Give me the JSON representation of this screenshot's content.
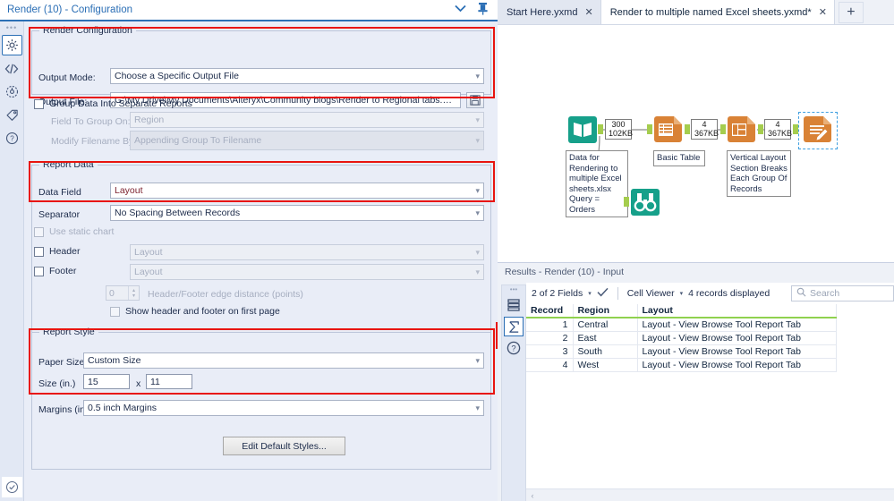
{
  "config": {
    "title": "Render (10) - Configuration",
    "collapse_icon": "chevron-down-icon",
    "pin_icon": "pin-icon",
    "rail": [
      {
        "name": "gear-icon",
        "label": "Configuration"
      },
      {
        "name": "code-icon",
        "label": "XML"
      },
      {
        "name": "annotation-icon",
        "label": "Annotation"
      },
      {
        "name": "tag-icon",
        "label": "Tag"
      },
      {
        "name": "help-icon",
        "label": "Help"
      }
    ],
    "status_icon": "check-circle-icon",
    "render_configuration": {
      "legend": "Render Configuration",
      "output_mode_label": "Output Mode:",
      "output_mode_value": "Choose a Specific Output File",
      "output_file_label": "Output File:",
      "output_file_value": "G:\\My Drive\\My Documents\\Alteryx\\Community blogs\\Render to Regional tabs.xlsx",
      "save_icon": "save-disk-icon"
    },
    "grouping": {
      "group_checkbox_label": "Group Data Into Separate Reports",
      "group_checked": false,
      "field_to_group_label": "Field To Group On:",
      "field_to_group_value": "Region",
      "modify_filename_label": "Modify Filename By:",
      "modify_filename_value": "Appending Group To Filename"
    },
    "report_data": {
      "legend": "Report Data",
      "data_field_label": "Data Field",
      "data_field_value": "Layout",
      "separator_label": "Separator",
      "separator_value": "No Spacing Between Records",
      "use_static_chart_label": "Use static chart",
      "use_static_chart_checked": false,
      "header_label": "Header",
      "header_value": "Layout",
      "header_checked": false,
      "footer_label": "Footer",
      "footer_value": "Layout",
      "footer_checked": false,
      "edge_distance_value": "0",
      "edge_distance_label": "Header/Footer edge distance (points)",
      "show_hf_first_page_label": "Show header and footer on first page",
      "show_hf_first_page_checked": false
    },
    "report_style": {
      "legend": "Report Style",
      "paper_size_label": "Paper Size",
      "paper_size_value": "Custom Size",
      "size_label": "Size (in.)",
      "size_width": "15",
      "size_x": "x",
      "size_height": "11",
      "margins_label": "Margins (in.)",
      "margins_value": "0.5 inch Margins",
      "edit_styles_button": "Edit Default Styles..."
    },
    "highlight_color": "#e8150f"
  },
  "tabs": {
    "items": [
      {
        "label": "Start Here.yxmd",
        "active": false,
        "close_icon": "close-icon"
      },
      {
        "label": "Render to multiple named Excel sheets.yxmd*",
        "active": true,
        "close_icon": "close-icon"
      }
    ],
    "add_label": "+",
    "add_icon": "plus-icon"
  },
  "canvas": {
    "tools": [
      {
        "name": "input-data-tool",
        "icon": "book-icon",
        "color": "#16a08a",
        "annotation": "Data for\nRendering to\nmultiple Excel\nsheets.xlsx\nQuery = Orders"
      },
      {
        "name": "basic-table-tool",
        "icon": "table-icon",
        "color": "#d98236",
        "annotation": "Basic Table"
      },
      {
        "name": "layout-tool",
        "icon": "layout-icon",
        "color": "#d98236",
        "annotation": "Vertical Layout\nSection Breaks\nEach Group Of\nRecords"
      },
      {
        "name": "render-tool",
        "icon": "render-icon",
        "color": "#d98236",
        "annotation": "",
        "selected": true
      },
      {
        "name": "browse-tool",
        "icon": "binoculars-icon",
        "color": "#16a08a",
        "annotation": ""
      }
    ],
    "connections": [
      {
        "records": "300",
        "size": "102KB"
      },
      {
        "records": "4",
        "size": "367KB"
      },
      {
        "records": "4",
        "size": "367KB"
      }
    ]
  },
  "results": {
    "title": "Results - Render (10) - Input",
    "rail": [
      {
        "name": "records-icon"
      },
      {
        "name": "sigma-icon",
        "active": true
      },
      {
        "name": "help-icon"
      }
    ],
    "toolbar": {
      "fields_label": "2 of 2 Fields",
      "fields_caret": "chevron-down-icon",
      "check_icon": "check-icon",
      "cell_viewer_label": "Cell Viewer",
      "cell_viewer_caret": "chevron-down-icon",
      "records_displayed": "4 records displayed",
      "search_placeholder": "Search",
      "search_icon": "search-icon",
      "search_value": ""
    },
    "grid": {
      "columns": [
        "Record",
        "Region",
        "Layout"
      ],
      "rows": [
        [
          "1",
          "Central",
          "Layout - View Browse Tool Report Tab"
        ],
        [
          "2",
          "East",
          "Layout - View Browse Tool Report Tab"
        ],
        [
          "3",
          "South",
          "Layout - View Browse Tool Report Tab"
        ],
        [
          "4",
          "West",
          "Layout - View Browse Tool Report Tab"
        ]
      ]
    },
    "scroll_left_icon": "chevron-left-icon",
    "header_underline_color": "#8fd14f",
    "link_color": "#6b2d8f"
  }
}
